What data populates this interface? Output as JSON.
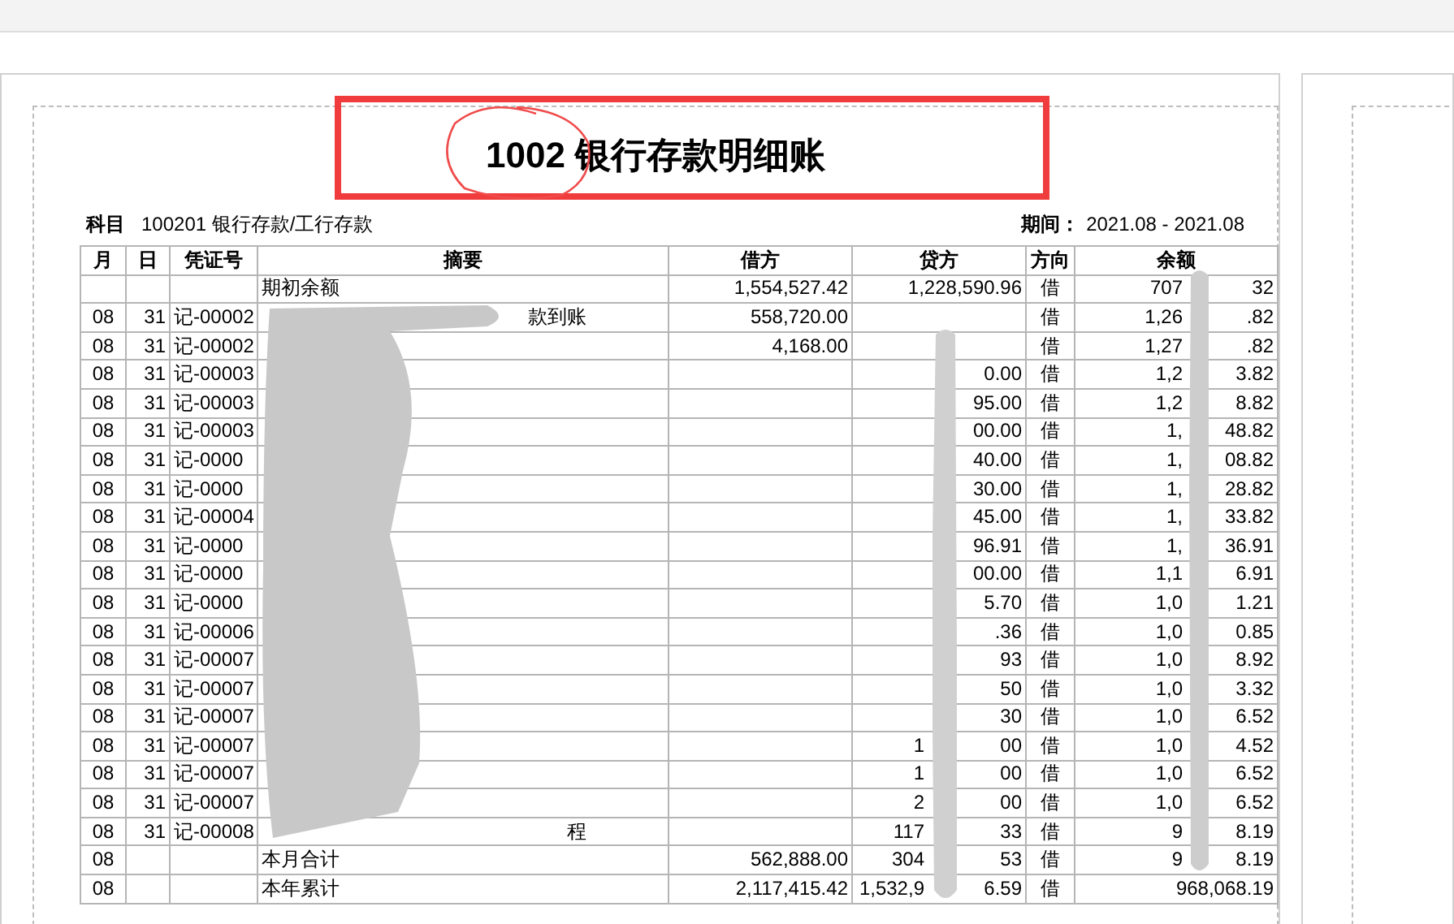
{
  "title": {
    "code": "1002",
    "text": "银行存款明细账"
  },
  "subject": {
    "label": "科目",
    "value": "100201 银行存款/工行存款"
  },
  "period": {
    "label": "期间：",
    "value": "2021.08 - 2021.08"
  },
  "columns": [
    "月",
    "日",
    "凭证号",
    "摘要",
    "借方",
    "贷方",
    "方向",
    "余额"
  ],
  "rows": [
    {
      "month": "",
      "day": "",
      "voucher": "",
      "summary": "期初余额",
      "debit": "1,554,527.42",
      "credit": [
        "1,228,590.96"
      ],
      "direction": "借",
      "balance": [
        "707",
        "32"
      ]
    },
    {
      "month": "08",
      "day": "31",
      "voucher": "记-00002",
      "summary": "款到账",
      "debit": "558,720.00",
      "credit": [],
      "direction": "借",
      "balance": [
        "1,26",
        ".82"
      ]
    },
    {
      "month": "08",
      "day": "31",
      "voucher": "记-00002",
      "summary": "",
      "debit": "4,168.00",
      "credit": [],
      "direction": "借",
      "balance": [
        "1,27",
        ".82"
      ]
    },
    {
      "month": "08",
      "day": "31",
      "voucher": "记-00003",
      "summary": "",
      "debit": "",
      "credit": [
        "0.00"
      ],
      "direction": "借",
      "balance": [
        "1,2",
        "3.82"
      ]
    },
    {
      "month": "08",
      "day": "31",
      "voucher": "记-00003",
      "summary": "",
      "debit": "",
      "credit": [
        "95.00"
      ],
      "direction": "借",
      "balance": [
        "1,2",
        "8.82"
      ]
    },
    {
      "month": "08",
      "day": "31",
      "voucher": "记-00003",
      "summary": "",
      "debit": "",
      "credit": [
        "00.00"
      ],
      "direction": "借",
      "balance": [
        "1,",
        "48.82"
      ]
    },
    {
      "month": "08",
      "day": "31",
      "voucher": "记-0000",
      "summary": "",
      "debit": "",
      "credit": [
        "40.00"
      ],
      "direction": "借",
      "balance": [
        "1,",
        "08.82"
      ]
    },
    {
      "month": "08",
      "day": "31",
      "voucher": "记-0000",
      "summary": "",
      "debit": "",
      "credit": [
        "30.00"
      ],
      "direction": "借",
      "balance": [
        "1,",
        "28.82"
      ]
    },
    {
      "month": "08",
      "day": "31",
      "voucher": "记-00004",
      "summary": "",
      "debit": "",
      "credit": [
        "45.00"
      ],
      "direction": "借",
      "balance": [
        "1,",
        "33.82"
      ]
    },
    {
      "month": "08",
      "day": "31",
      "voucher": "记-0000",
      "summary": "",
      "debit": "",
      "credit": [
        "96.91"
      ],
      "direction": "借",
      "balance": [
        "1,",
        "36.91"
      ]
    },
    {
      "month": "08",
      "day": "31",
      "voucher": "记-0000",
      "summary": "",
      "debit": "",
      "credit": [
        "00.00"
      ],
      "direction": "借",
      "balance": [
        "1,1",
        "6.91"
      ]
    },
    {
      "month": "08",
      "day": "31",
      "voucher": "记-0000",
      "summary": "",
      "debit": "",
      "credit": [
        "5.70"
      ],
      "direction": "借",
      "balance": [
        "1,0",
        "1.21"
      ]
    },
    {
      "month": "08",
      "day": "31",
      "voucher": "记-00006",
      "summary": "",
      "debit": "",
      "credit": [
        ".36"
      ],
      "direction": "借",
      "balance": [
        "1,0",
        "0.85"
      ]
    },
    {
      "month": "08",
      "day": "31",
      "voucher": "记-00007",
      "summary": "",
      "debit": "",
      "credit": [
        "93"
      ],
      "direction": "借",
      "balance": [
        "1,0",
        "8.92"
      ]
    },
    {
      "month": "08",
      "day": "31",
      "voucher": "记-00007",
      "summary": "",
      "debit": "",
      "credit": [
        "50"
      ],
      "direction": "借",
      "balance": [
        "1,0",
        "3.32"
      ]
    },
    {
      "month": "08",
      "day": "31",
      "voucher": "记-00007",
      "summary": "",
      "debit": "",
      "credit": [
        "30"
      ],
      "direction": "借",
      "balance": [
        "1,0",
        "6.52"
      ]
    },
    {
      "month": "08",
      "day": "31",
      "voucher": "记-00007",
      "summary": "",
      "debit": "",
      "credit": [
        "1",
        "00"
      ],
      "direction": "借",
      "balance": [
        "1,0",
        "4.52"
      ]
    },
    {
      "month": "08",
      "day": "31",
      "voucher": "记-00007",
      "summary": "",
      "debit": "",
      "credit": [
        "1",
        "00"
      ],
      "direction": "借",
      "balance": [
        "1,0",
        "6.52"
      ]
    },
    {
      "month": "08",
      "day": "31",
      "voucher": "记-00007",
      "summary": "",
      "debit": "",
      "credit": [
        "2",
        "00"
      ],
      "direction": "借",
      "balance": [
        "1,0",
        "6.52"
      ]
    },
    {
      "month": "08",
      "day": "31",
      "voucher": "记-00008",
      "summary": "程",
      "debit": "",
      "credit": [
        "117",
        "33"
      ],
      "direction": "借",
      "balance": [
        "9",
        "8.19"
      ]
    },
    {
      "month": "08",
      "day": "",
      "voucher": "",
      "summary": "本月合计",
      "debit": "562,888.00",
      "credit": [
        "304",
        "53"
      ],
      "direction": "借",
      "balance": [
        "9",
        "8.19"
      ]
    },
    {
      "month": "08",
      "day": "",
      "voucher": "",
      "summary": "本年累计",
      "debit": "2,117,415.42",
      "credit": [
        "1,532,9",
        "6.59"
      ],
      "direction": "借",
      "balance": [
        "968,068.19"
      ]
    }
  ]
}
